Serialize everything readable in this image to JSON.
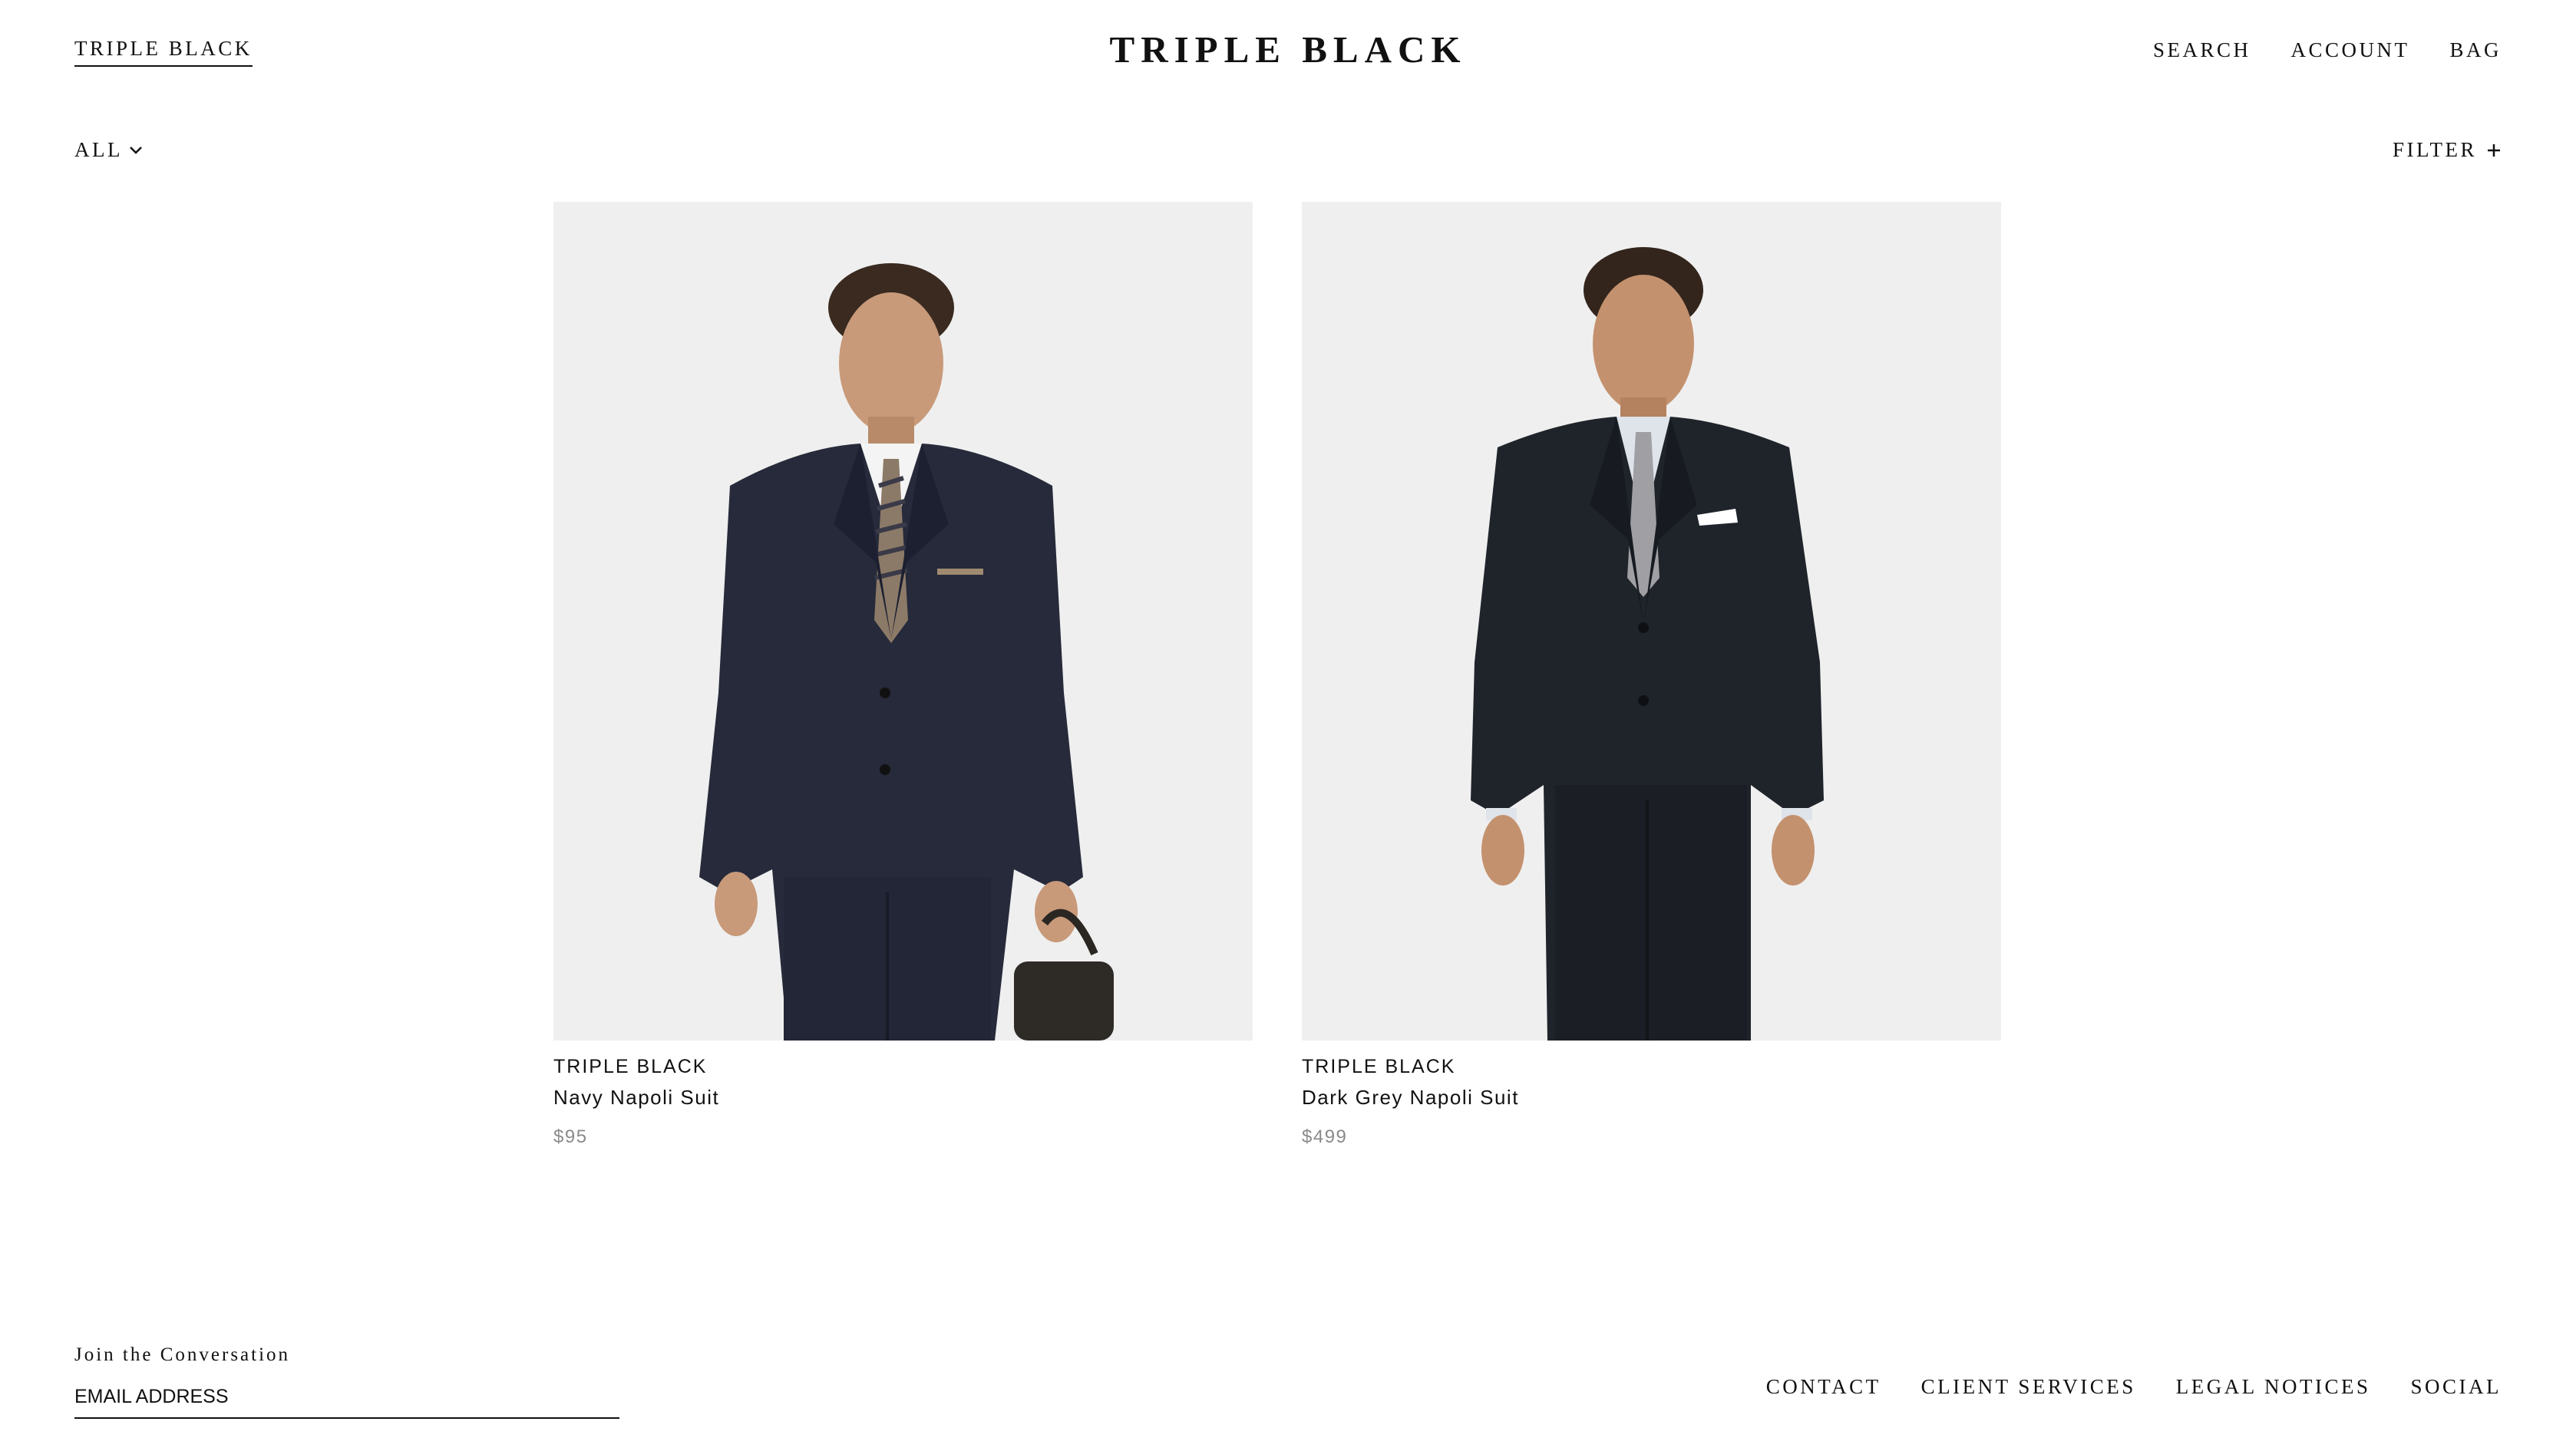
{
  "header": {
    "brand_link": "TRIPLE BLACK",
    "logo": "TRIPLE BLACK",
    "nav": [
      "SEARCH",
      "ACCOUNT",
      "BAG"
    ]
  },
  "toolbar": {
    "category_label": "ALL",
    "filter_label": "FILTER"
  },
  "products": [
    {
      "brand": "TRIPLE BLACK",
      "name": "Navy Napoli Suit",
      "price": "$95",
      "suit_color": "#262a3a"
    },
    {
      "brand": "TRIPLE BLACK",
      "name": "Dark Grey Napoli Suit",
      "price": "$499",
      "suit_color": "#1f242b"
    }
  ],
  "footer": {
    "newsletter_label": "Join the Conversation",
    "email_placeholder": "EMAIL ADDRESS",
    "links": [
      "CONTACT",
      "CLIENT SERVICES",
      "LEGAL NOTICES",
      "SOCIAL"
    ]
  },
  "colors": {
    "text": "#111111",
    "muted": "#8a8a8a",
    "image_bg": "#efefef"
  }
}
